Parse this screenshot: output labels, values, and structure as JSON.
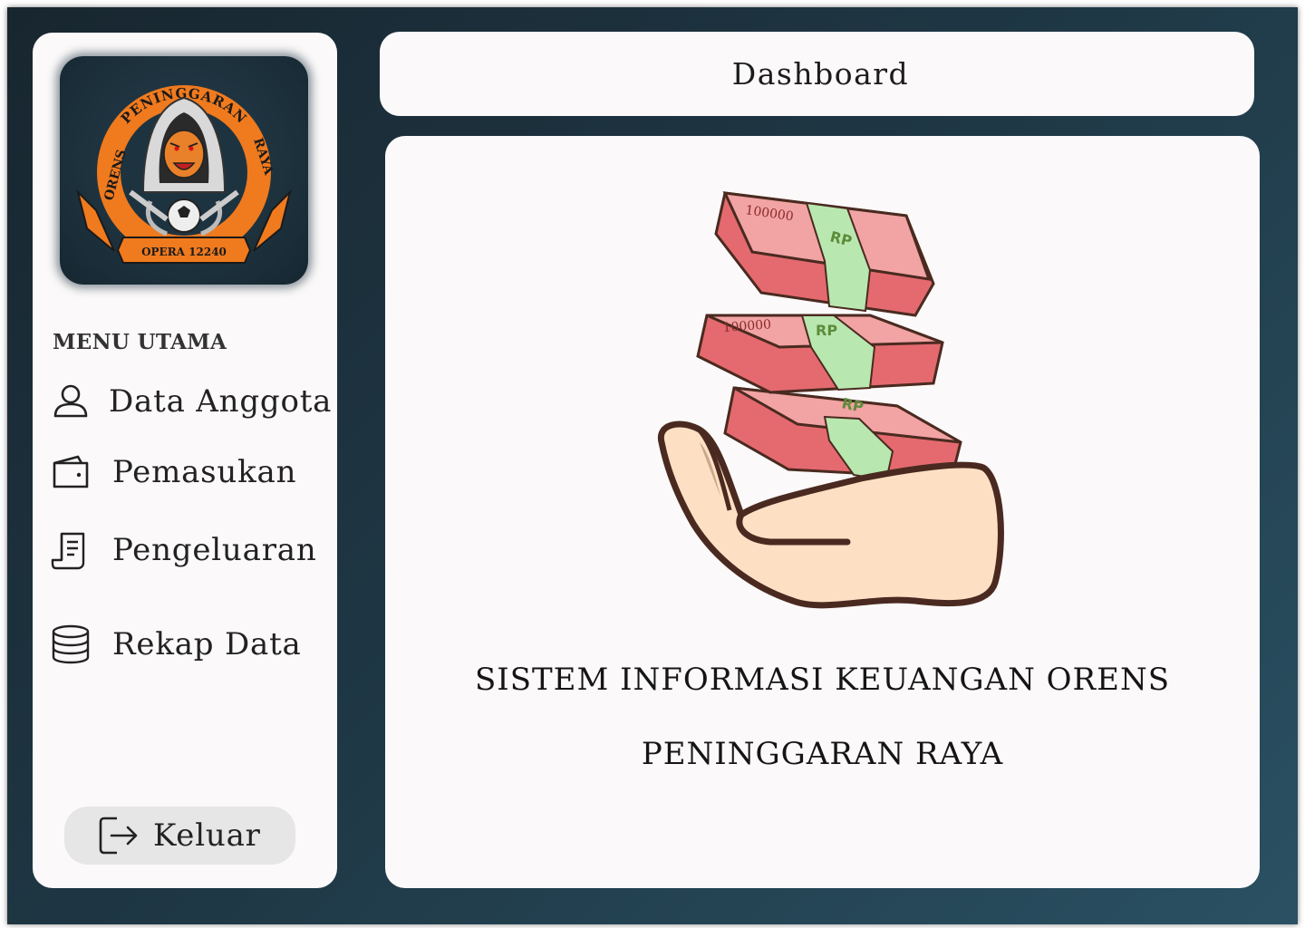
{
  "logo": {
    "name": "orens-peninggaran-raya-logo",
    "text_top": "PENINGGARAN",
    "text_left": "ORENS",
    "text_right": "RAYA",
    "text_bottom": "OPERA 12240",
    "colors": {
      "ring": "#f07a1e",
      "ring_text": "#1a1a1a",
      "tiger": "#e9802a",
      "hood": "#d9d9d9"
    }
  },
  "sidebar": {
    "menu_heading": "MENU UTAMA",
    "items": [
      {
        "label": "Data Anggota",
        "icon": "user-icon"
      },
      {
        "label": "Pemasukan",
        "icon": "wallet-icon"
      },
      {
        "label": "Pengeluaran",
        "icon": "receipt-icon"
      },
      {
        "label": "Rekap Data",
        "icon": "database-icon"
      }
    ],
    "logout_label": "Keluar",
    "logout_icon": "logout-icon"
  },
  "header": {
    "title": "Dashboard"
  },
  "main": {
    "illustration": {
      "name": "money-in-hand-illustration",
      "banknote_denomination": "100000",
      "band_text": "RP",
      "colors": {
        "note": "#f08c8c",
        "note_dark": "#c6373e",
        "band": "#b9e7b0",
        "hand": "#fde0c4",
        "outline": "#4a2a20"
      }
    },
    "tagline_line1": "SISTEM INFORMASI KEUANGAN  ORENS",
    "tagline_line2": "PENINGGARAN RAYA"
  },
  "colors": {
    "background_gradient_start": "#18262f",
    "background_gradient_end": "#2a5163",
    "panel": "#fbf9f9",
    "logout_button": "#e6e6e6"
  }
}
